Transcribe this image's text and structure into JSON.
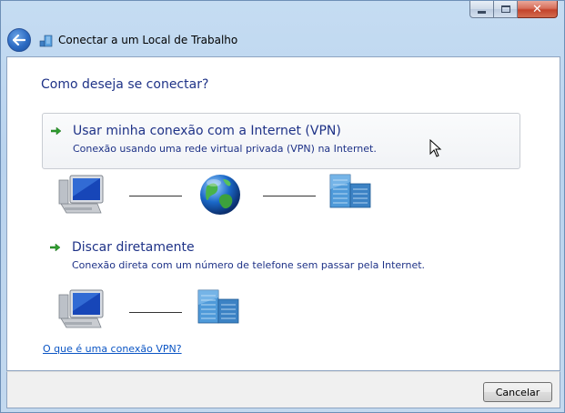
{
  "window": {
    "title": "Conectar a um Local de Trabalho",
    "buttons": {
      "minimize": "minimize",
      "maximize": "maximize",
      "close": "close"
    }
  },
  "main": {
    "instruction": "Como deseja se conectar?",
    "options": [
      {
        "title": "Usar minha conexão com a Internet (VPN)",
        "description": "Conexão usando uma rede virtual privada (VPN) na Internet.",
        "icon": "green-arrow-icon",
        "diagram": [
          "computer-icon",
          "globe-icon",
          "office-building-icon"
        ]
      },
      {
        "title": "Discar diretamente",
        "description": "Conexão direta com um número de telefone sem passar pela Internet.",
        "icon": "green-arrow-icon",
        "diagram": [
          "computer-icon",
          "office-building-icon"
        ]
      }
    ],
    "help_link": "O que é uma conexão VPN?"
  },
  "footer": {
    "cancel_label": "Cancelar"
  },
  "colors": {
    "instruction_text": "#1e3287",
    "link": "#0b55c4",
    "frame": "#b9d3ee",
    "close_button": "#c3432b"
  }
}
